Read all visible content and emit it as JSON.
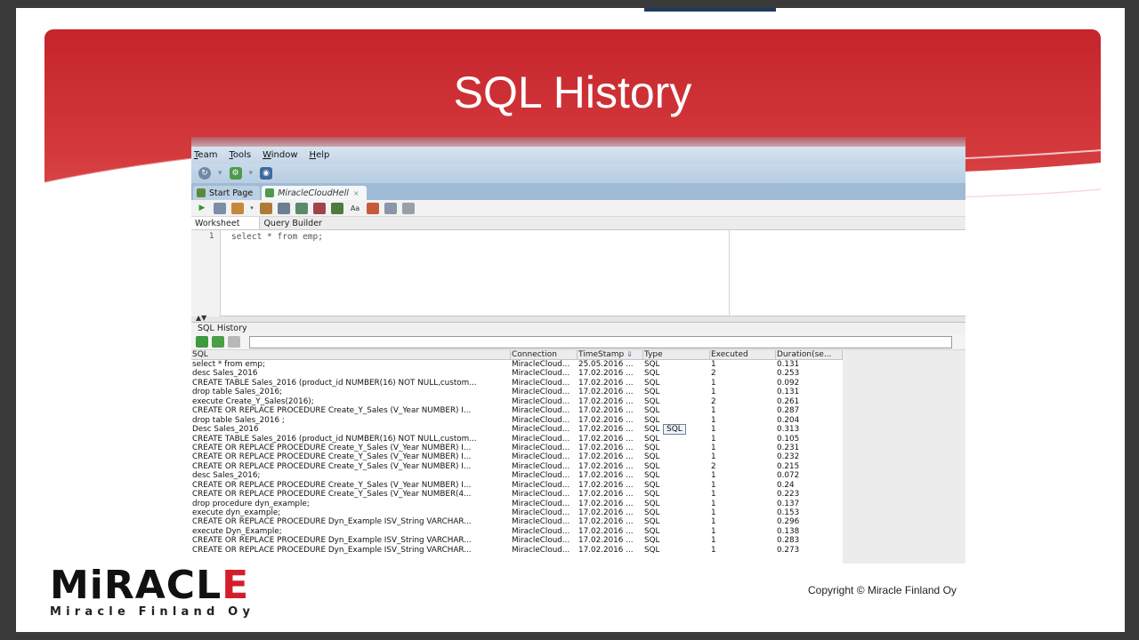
{
  "slide": {
    "title": "SQL History",
    "copyright": "Copyright © Miracle Finland Oy",
    "logo": {
      "word_left": "MiRACL",
      "word_right": "E",
      "subtitle": "Miracle Finland Oy",
      "accent_color": "#d21f2b"
    }
  },
  "app": {
    "menu": [
      "Team",
      "Tools",
      "Window",
      "Help"
    ],
    "tabs": {
      "start_page": "Start Page",
      "connection": "MiracleCloudHell"
    },
    "subtabs": {
      "worksheet": "Worksheet",
      "query_builder": "Query Builder"
    },
    "editor": {
      "line_number": "1",
      "code": "select * from emp;"
    },
    "history": {
      "title": "SQL History",
      "tooltip": "SQL",
      "columns": {
        "sql": "SQL",
        "connection": "Connection",
        "timestamp": "TimeStamp",
        "type": "Type",
        "executed": "Executed",
        "duration": "Duration(se..."
      },
      "rows": [
        {
          "sql": "select * from emp;",
          "conn": "MiracleCloud...",
          "ts": "25.05.2016 ...",
          "type": "SQL",
          "exec": "1",
          "dur": "0.131"
        },
        {
          "sql": "desc Sales_2016",
          "conn": "MiracleCloud...",
          "ts": "17.02.2016 ...",
          "type": "SQL",
          "exec": "2",
          "dur": "0.253"
        },
        {
          "sql": "CREATE TABLE Sales_2016 (product_id NUMBER(16) NOT NULL,custom...",
          "conn": "MiracleCloud...",
          "ts": "17.02.2016 ...",
          "type": "SQL",
          "exec": "1",
          "dur": "0.092"
        },
        {
          "sql": "drop table Sales_2016;",
          "conn": "MiracleCloud...",
          "ts": "17.02.2016 ...",
          "type": "SQL",
          "exec": "1",
          "dur": "0.131"
        },
        {
          "sql": "execute Create_Y_Sales(2016);",
          "conn": "MiracleCloud...",
          "ts": "17.02.2016 ...",
          "type": "SQL",
          "exec": "2",
          "dur": "0.261"
        },
        {
          "sql": "CREATE OR REPLACE PROCEDURE Create_Y_Sales (V_Year NUMBER) I...",
          "conn": "MiracleCloud...",
          "ts": "17.02.2016 ...",
          "type": "SQL",
          "exec": "1",
          "dur": "0.287"
        },
        {
          "sql": "drop table Sales_2016 ;",
          "conn": "MiracleCloud...",
          "ts": "17.02.2016 ...",
          "type": "SQL",
          "exec": "1",
          "dur": "0.204"
        },
        {
          "sql": "Desc Sales_2016",
          "conn": "MiracleCloud...",
          "ts": "17.02.2016 ...",
          "type": "SQL",
          "exec": "1",
          "dur": "0.313"
        },
        {
          "sql": "CREATE TABLE Sales_2016 (product_id NUMBER(16) NOT NULL,custom...",
          "conn": "MiracleCloud...",
          "ts": "17.02.2016 ...",
          "type": "SQL",
          "exec": "1",
          "dur": "0.105"
        },
        {
          "sql": "CREATE OR REPLACE PROCEDURE Create_Y_Sales (V_Year NUMBER) I...",
          "conn": "MiracleCloud...",
          "ts": "17.02.2016 ...",
          "type": "SQL",
          "exec": "1",
          "dur": "0.231"
        },
        {
          "sql": "CREATE OR REPLACE PROCEDURE Create_Y_Sales (V_Year NUMBER) I...",
          "conn": "MiracleCloud...",
          "ts": "17.02.2016 ...",
          "type": "SQL",
          "exec": "1",
          "dur": "0.232"
        },
        {
          "sql": "CREATE OR REPLACE PROCEDURE Create_Y_Sales (V_Year NUMBER) I...",
          "conn": "MiracleCloud...",
          "ts": "17.02.2016 ...",
          "type": "SQL",
          "exec": "2",
          "dur": "0.215"
        },
        {
          "sql": "desc Sales_2016;",
          "conn": "MiracleCloud...",
          "ts": "17.02.2016 ...",
          "type": "SQL",
          "exec": "1",
          "dur": "0.072"
        },
        {
          "sql": "CREATE OR REPLACE PROCEDURE Create_Y_Sales (V_Year NUMBER) I...",
          "conn": "MiracleCloud...",
          "ts": "17.02.2016 ...",
          "type": "SQL",
          "exec": "1",
          "dur": "0.24"
        },
        {
          "sql": "CREATE OR REPLACE PROCEDURE Create_Y_Sales (V_Year NUMBER(4...",
          "conn": "MiracleCloud...",
          "ts": "17.02.2016 ...",
          "type": "SQL",
          "exec": "1",
          "dur": "0.223"
        },
        {
          "sql": "drop procedure dyn_example;",
          "conn": "MiracleCloud...",
          "ts": "17.02.2016 ...",
          "type": "SQL",
          "exec": "1",
          "dur": "0.137"
        },
        {
          "sql": "execute dyn_example;",
          "conn": "MiracleCloud...",
          "ts": "17.02.2016 ...",
          "type": "SQL",
          "exec": "1",
          "dur": "0.153"
        },
        {
          "sql": "CREATE OR REPLACE PROCEDURE Dyn_Example ISV_String VARCHAR...",
          "conn": "MiracleCloud...",
          "ts": "17.02.2016 ...",
          "type": "SQL",
          "exec": "1",
          "dur": "0.296"
        },
        {
          "sql": "execute Dyn_Example;",
          "conn": "MiracleCloud...",
          "ts": "17.02.2016 ...",
          "type": "SQL",
          "exec": "1",
          "dur": "0.138"
        },
        {
          "sql": "CREATE OR REPLACE PROCEDURE Dyn_Example ISV_String VARCHAR...",
          "conn": "MiracleCloud...",
          "ts": "17.02.2016 ...",
          "type": "SQL",
          "exec": "1",
          "dur": "0.283"
        },
        {
          "sql": "CREATE OR REPLACE PROCEDURE Dyn_Example ISV_String VARCHAR...",
          "conn": "MiracleCloud...",
          "ts": "17.02.2016 ...",
          "type": "SQL",
          "exec": "1",
          "dur": "0.273"
        }
      ]
    }
  },
  "colors": {
    "banner_red": "#c4252b",
    "app_blue": "#c4d6e8",
    "tab_blue": "#9fbad4"
  }
}
